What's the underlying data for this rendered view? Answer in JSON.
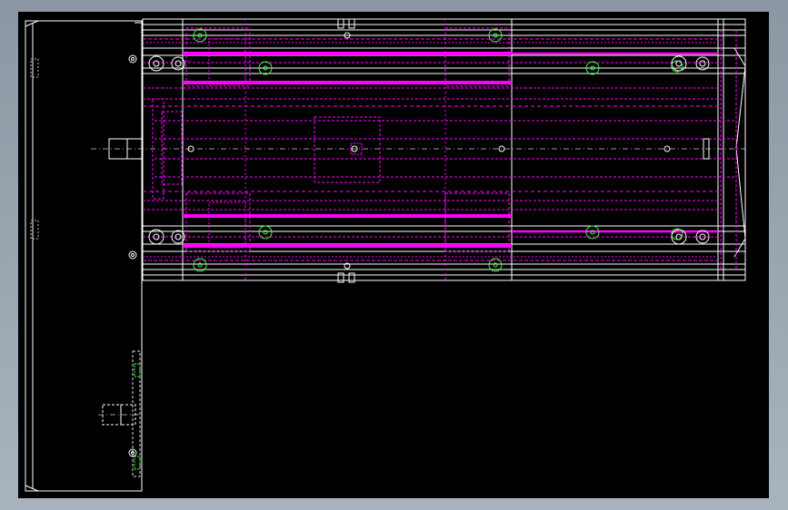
{
  "viewport": {
    "background": "#000000",
    "outer_background": "#9aa4ae"
  },
  "colors": {
    "outline": "#ffffff",
    "hidden_lines": "#ff00ff",
    "holes": "#40ff40",
    "centerline": "#c8c8c8"
  },
  "drawing": {
    "views": [
      "side-view",
      "top-view-rail-assembly"
    ],
    "icons": [
      "rail-assembly",
      "carriage-plate",
      "motor-mount",
      "end-cap"
    ]
  }
}
